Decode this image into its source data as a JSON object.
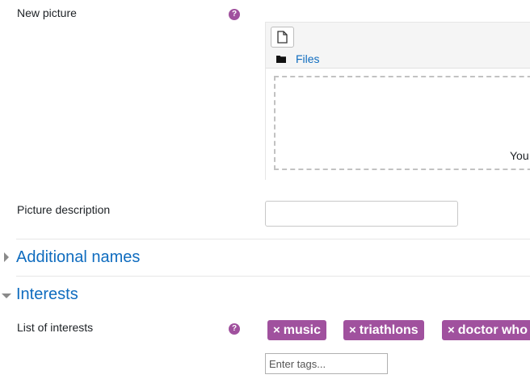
{
  "fields": {
    "new_picture": {
      "label": "New picture",
      "help_icon": "question-circle-icon",
      "help_glyph": "?"
    },
    "filemanager": {
      "add_file_icon": "file-icon",
      "folder_icon": "folder-icon",
      "files_label": "Files",
      "dropzone_text": "You"
    },
    "picture_description": {
      "label": "Picture description",
      "value": ""
    }
  },
  "sections": {
    "additional_names": {
      "title": "Additional names",
      "state": "collapsed"
    },
    "interests": {
      "title": "Interests",
      "state": "expanded",
      "list_label": "List of interests",
      "help_glyph": "?",
      "tags": [
        {
          "remove_glyph": "×",
          "label": "music"
        },
        {
          "remove_glyph": "×",
          "label": "triathlons"
        },
        {
          "remove_glyph": "×",
          "label": "doctor who"
        }
      ],
      "tags_input_placeholder": "Enter tags...",
      "tag_color": "#a0519e"
    }
  },
  "colors": {
    "link": "#0f6cbf",
    "help": "#a0519e"
  }
}
